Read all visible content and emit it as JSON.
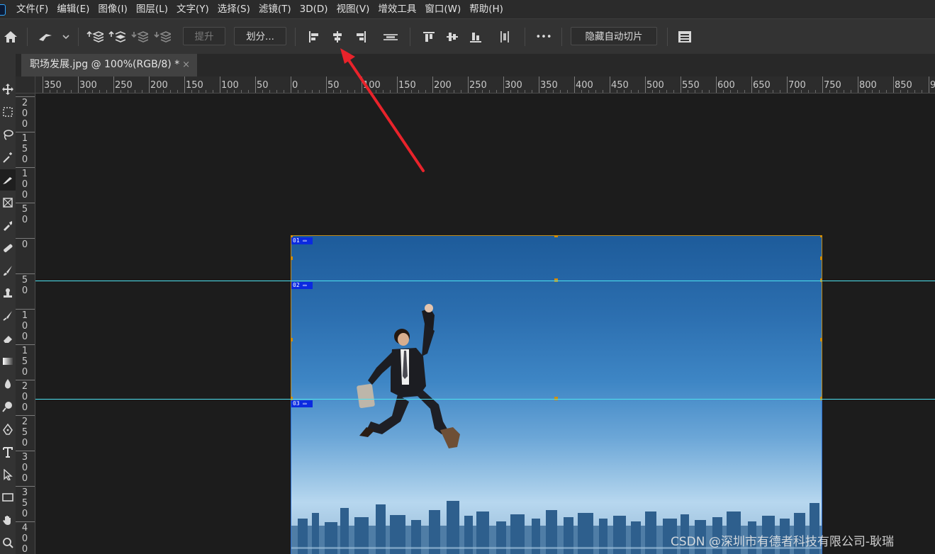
{
  "menu": [
    "文件(F)",
    "编辑(E)",
    "图像(I)",
    "图层(L)",
    "文字(Y)",
    "选择(S)",
    "滤镜(T)",
    "3D(D)",
    "视图(V)",
    "增效工具",
    "窗口(W)",
    "帮助(H)"
  ],
  "options": {
    "raise_label": "提升",
    "divide_label": "划分...",
    "more_label": "•••",
    "hide_auto_slices_label": "隐藏自动切片"
  },
  "document_tab": {
    "title": "职场发展.jpg @ 100%(RGB/8) *",
    "close": "×"
  },
  "ruler": {
    "h_labels": [
      "350",
      "300",
      "250",
      "200",
      "150",
      "100",
      "50",
      "0",
      "50",
      "100",
      "150",
      "200",
      "250",
      "300",
      "350",
      "400",
      "450",
      "500",
      "550",
      "600",
      "650",
      "700",
      "750",
      "800",
      "850",
      "9"
    ],
    "v_labels": [
      "2\n0\n0",
      "1\n5\n0",
      "1\n0\n0",
      "5\n0",
      "0",
      "5\n0",
      "1\n0\n0",
      "1\n5\n0",
      "2\n0\n0",
      "2\n5\n0",
      "3\n0\n0",
      "3\n5\n0",
      "4\n0\n0"
    ]
  },
  "slices": [
    {
      "tag": "01"
    },
    {
      "tag": "02"
    },
    {
      "tag": "03"
    }
  ],
  "watermark": "CSDN @深圳市有德者科技有限公司-耿瑞",
  "colors": {
    "guide": "#4de2f0",
    "slice_border": "#c08a17",
    "slice_tag_bg": "#0b2ae0",
    "annotation_arrow": "#e8232b"
  },
  "tools": [
    "move-icon",
    "marquee-icon",
    "lasso-icon",
    "magic-wand-icon",
    "slice-tool-icon",
    "frame-icon",
    "eyedropper-icon",
    "healing-brush-icon",
    "brush-icon",
    "clone-stamp-icon",
    "history-brush-icon",
    "eraser-icon",
    "gradient-icon",
    "blur-icon",
    "dodge-icon",
    "pen-icon",
    "type-icon",
    "path-selection-icon",
    "rectangle-icon",
    "hand-icon",
    "zoom-icon"
  ]
}
